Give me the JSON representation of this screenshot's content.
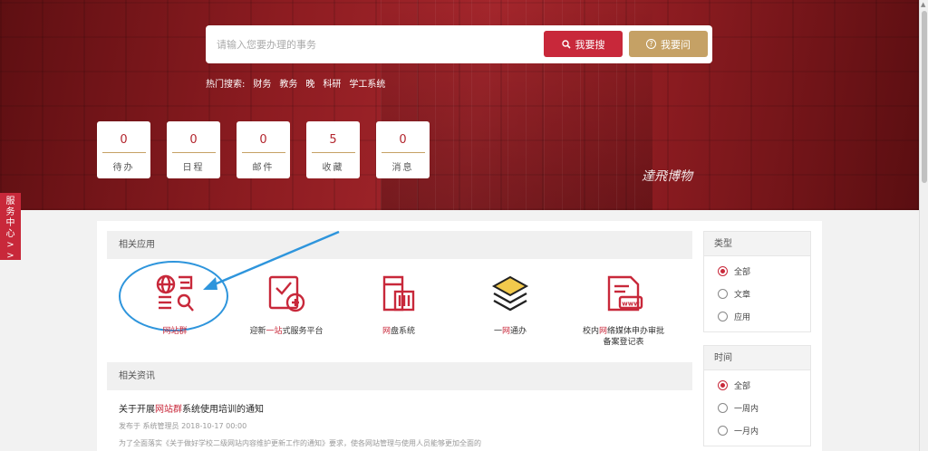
{
  "search": {
    "placeholder": "请输入您要办理的事务",
    "search_label": "我要搜",
    "ask_label": "我要问"
  },
  "hot": {
    "label": "热门搜索:",
    "items": [
      "财务",
      "教务",
      "晚",
      "科研",
      "学工系统"
    ]
  },
  "counters": [
    {
      "value": "0",
      "label": "待办"
    },
    {
      "value": "0",
      "label": "日程"
    },
    {
      "value": "0",
      "label": "邮件"
    },
    {
      "value": "5",
      "label": "收藏"
    },
    {
      "value": "0",
      "label": "消息"
    }
  ],
  "signature": "達飛博物",
  "side_tab": "服务中心>>",
  "apps_section": {
    "title": "相关应用",
    "apps": [
      {
        "name": "网站群"
      },
      {
        "name_pre": "迎新",
        "name_hl": "一站",
        "name_post": "式服务平台"
      },
      {
        "name_pre": "",
        "name_hl": "网",
        "name_post": "盘系统"
      },
      {
        "name_pre": "一",
        "name_hl": "网",
        "name_post": "通办"
      },
      {
        "name_pre": "校内",
        "name_hl": "网",
        "name_post": "络媒体申办审批",
        "line2": "备案登记表"
      }
    ]
  },
  "news_section": {
    "title": "相关资讯",
    "items": [
      {
        "title_pre": "关于开展",
        "title_hl": "网站群",
        "title_post": "系统使用培训的通知",
        "meta": "发布于 系统管理员 2018-10-17 00:00",
        "desc": "为了全面落实《关于做好学校二级网站内容维护更新工作的通知》要求，使各网站管理与使用人员能够更加全面的"
      }
    ]
  },
  "filters": {
    "type": {
      "title": "类型",
      "options": [
        "全部",
        "文章",
        "应用"
      ]
    },
    "time": {
      "title": "时间",
      "options": [
        "全部",
        "一周内",
        "一月内"
      ]
    }
  },
  "colors": {
    "brand_red": "#c8283a",
    "gold": "#c5a165",
    "highlight_blue": "#2e95dc"
  }
}
